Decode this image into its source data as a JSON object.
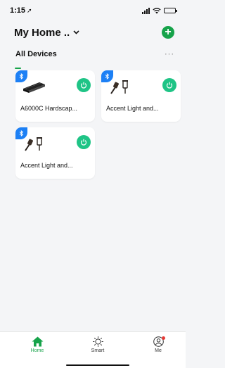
{
  "status_bar": {
    "time": "1:15"
  },
  "header": {
    "title": "My Home ..",
    "add_icon": "plus-icon"
  },
  "tabs": {
    "active_label": "All Devices",
    "more_label": "···"
  },
  "devices": [
    {
      "name": "A6000C Hardscap...",
      "image": "hardscape-light-icon",
      "connection": "bluetooth",
      "power": "on"
    },
    {
      "name": "Accent  Light and...",
      "image": "accent-light-icon",
      "connection": "bluetooth",
      "power": "on"
    },
    {
      "name": "Accent  Light and...",
      "image": "accent-light-icon",
      "connection": "bluetooth",
      "power": "on"
    }
  ],
  "tabbar": {
    "items": [
      {
        "label": "Home",
        "icon": "home-icon",
        "active": true
      },
      {
        "label": "Smart",
        "icon": "sun-icon",
        "active": false
      },
      {
        "label": "Me",
        "icon": "user-icon",
        "active": false
      }
    ]
  },
  "colors": {
    "accent": "#16a34a",
    "power_on": "#1fc486",
    "bluetooth_badge": "#1d80f5"
  }
}
